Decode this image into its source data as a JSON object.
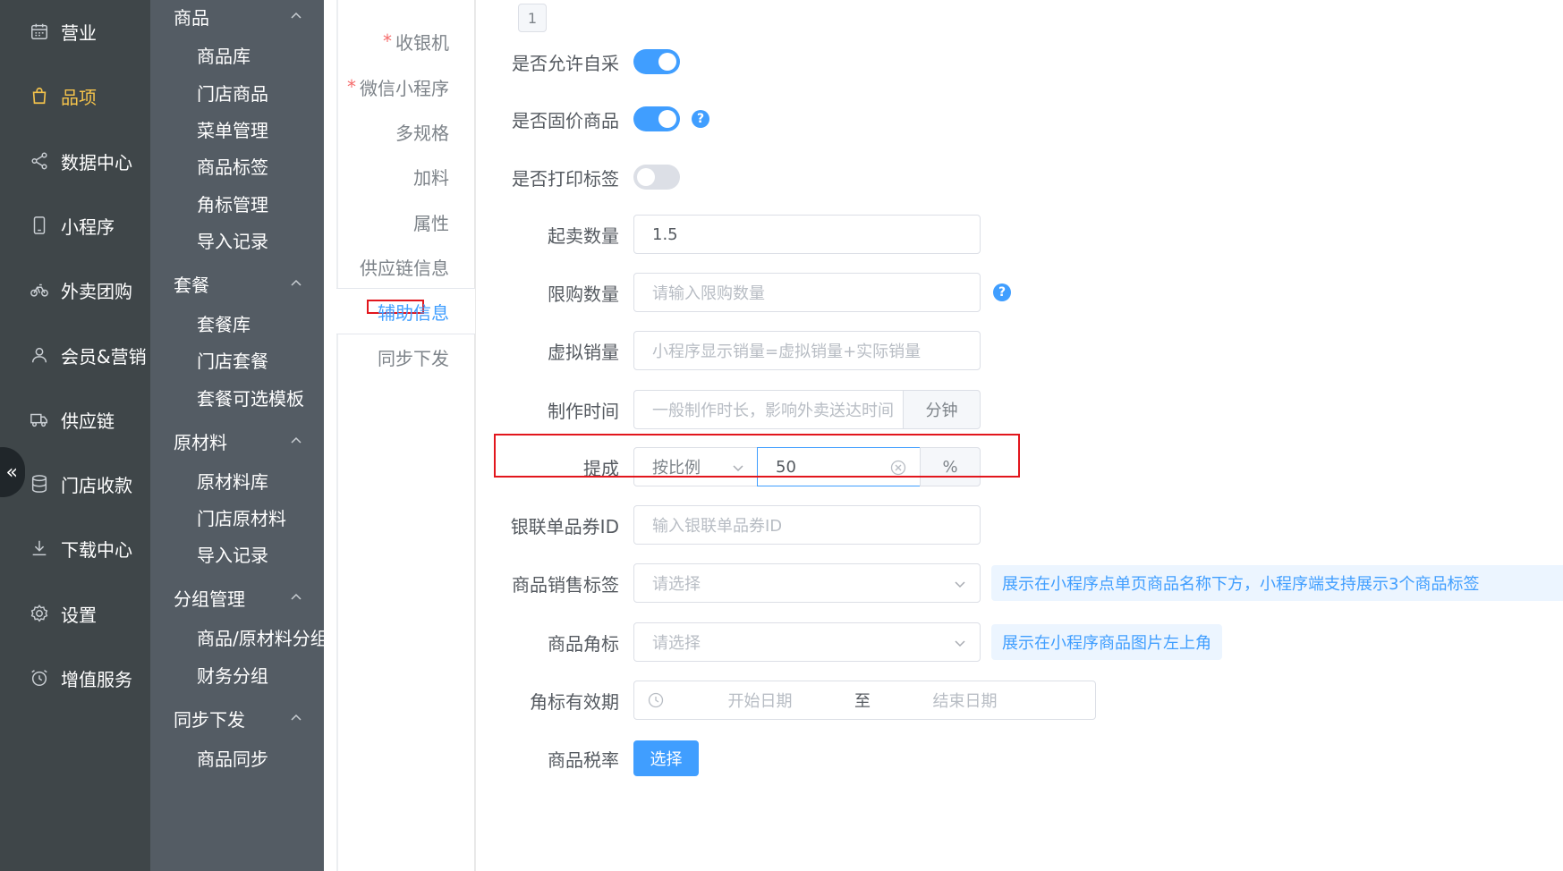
{
  "nav1": {
    "items": [
      {
        "label": "营业",
        "icon": "calendar-icon"
      },
      {
        "label": "品项",
        "icon": "bag-icon",
        "active": true
      },
      {
        "label": "数据中心",
        "icon": "share-icon"
      },
      {
        "label": "小程序",
        "icon": "phone-icon"
      },
      {
        "label": "外卖团购",
        "icon": "bike-icon"
      },
      {
        "label": "会员&营销",
        "icon": "user-icon"
      },
      {
        "label": "供应链",
        "icon": "truck-icon"
      },
      {
        "label": "门店收款",
        "icon": "database-icon"
      },
      {
        "label": "下载中心",
        "icon": "download-icon"
      },
      {
        "label": "设置",
        "icon": "gear-icon"
      },
      {
        "label": "增值服务",
        "icon": "alarm-icon"
      }
    ],
    "collapse_glyph": "«"
  },
  "nav2": {
    "groups": [
      {
        "label": "商品",
        "items": [
          "商品库",
          "门店商品",
          "菜单管理",
          "商品标签",
          "角标管理",
          "导入记录"
        ]
      },
      {
        "label": "套餐",
        "items": [
          "套餐库",
          "门店套餐",
          "套餐可选模板"
        ]
      },
      {
        "label": "原材料",
        "items": [
          "原材料库",
          "门店原材料",
          "导入记录"
        ]
      },
      {
        "label": "分组管理",
        "items": [
          "商品/原材料分组",
          "财务分组"
        ]
      },
      {
        "label": "同步下发",
        "items": [
          "商品同步"
        ]
      }
    ]
  },
  "tabs": {
    "items": [
      {
        "label": "收银机",
        "required": true
      },
      {
        "label": "微信小程序",
        "required": true
      },
      {
        "label": "多规格",
        "required": false
      },
      {
        "label": "加料",
        "required": false
      },
      {
        "label": "属性",
        "required": false
      },
      {
        "label": "供应链信息",
        "required": false
      },
      {
        "label": "辅助信息",
        "required": false,
        "active": true
      },
      {
        "label": "同步下发",
        "required": false
      }
    ],
    "required_mark": "*"
  },
  "form": {
    "pager_value": "1",
    "allow_self_purchase": {
      "label": "是否允许自采",
      "on": true
    },
    "fixed_price": {
      "label": "是否固价商品",
      "on": true,
      "help": "?"
    },
    "print_label": {
      "label": "是否打印标签",
      "on": false
    },
    "min_sale_qty": {
      "label": "起卖数量",
      "value": "1.5"
    },
    "limit_qty": {
      "label": "限购数量",
      "placeholder": "请输入限购数量",
      "help": "?"
    },
    "virtual_sales": {
      "label": "虚拟销量",
      "placeholder": "小程序显示销量=虚拟销量+实际销量"
    },
    "make_time": {
      "label": "制作时间",
      "placeholder": "一般制作时长，影响外卖送达时间",
      "unit": "分钟"
    },
    "commission": {
      "label": "提成",
      "mode": "按比例",
      "value": "50",
      "unit": "%"
    },
    "unionpay_id": {
      "label": "银联单品券ID",
      "placeholder": "输入银联单品券ID"
    },
    "sales_tag": {
      "label": "商品销售标签",
      "placeholder": "请选择",
      "tip": "展示在小程序点单页商品名称下方，小程序端支持展示3个商品标签"
    },
    "corner_mark": {
      "label": "商品角标",
      "placeholder": "请选择",
      "tip": "展示在小程序商品图片左上角"
    },
    "corner_validity": {
      "label": "角标有效期",
      "start_placeholder": "开始日期",
      "separator": "至",
      "end_placeholder": "结束日期"
    },
    "tax_rate": {
      "label": "商品税率",
      "button": "选择"
    }
  },
  "colors": {
    "nav1_bg": "#3f4649",
    "nav2_bg": "#545c64",
    "active_nav": "#f3c24b",
    "primary": "#409eff",
    "annotation": "#e2161d"
  }
}
